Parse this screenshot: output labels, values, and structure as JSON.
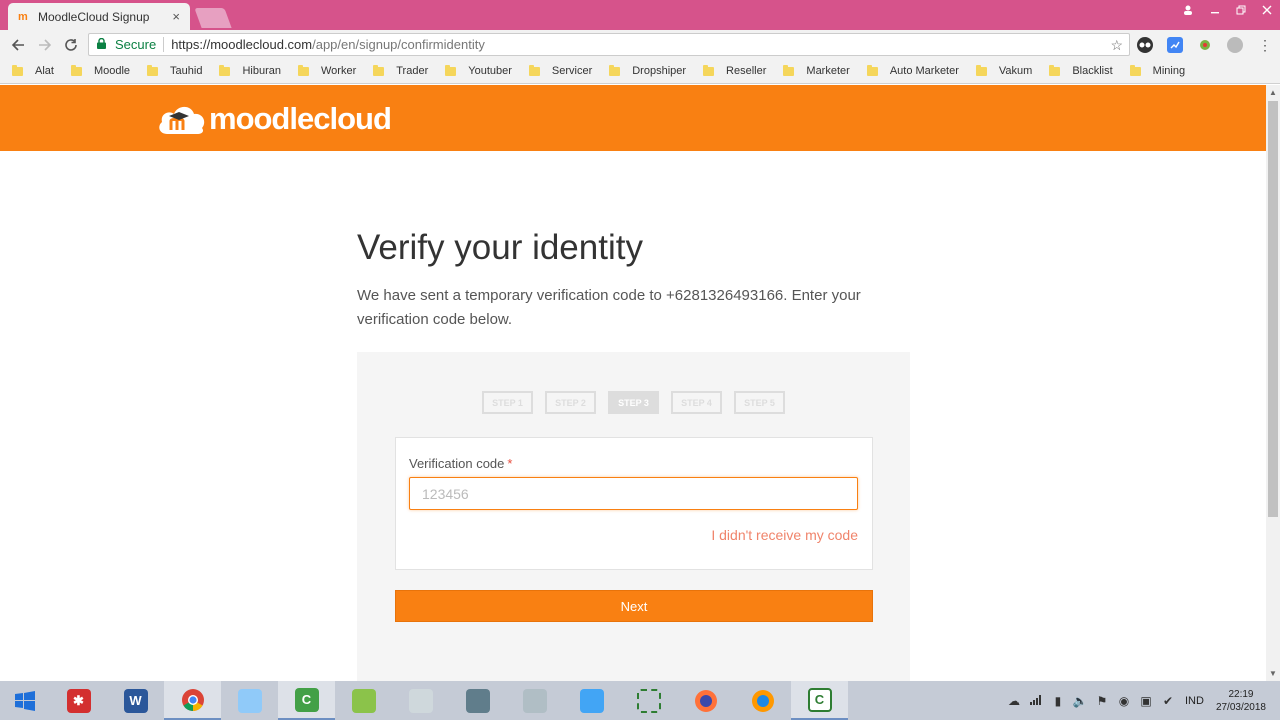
{
  "browser": {
    "tab_title": "MoodleCloud Signup",
    "tab_close": "×",
    "secure_label": "Secure",
    "url_host": "https://moodlecloud.com",
    "url_path": "/app/en/signup/confirmidentity",
    "bookmarks": [
      "Alat",
      "Moodle",
      "Tauhid",
      "Hiburan",
      "Worker",
      "Trader",
      "Youtuber",
      "Servicer",
      "Dropshiper",
      "Reseller",
      "Marketer",
      "Auto Marketer",
      "Vakum",
      "Blacklist",
      "Mining"
    ]
  },
  "site": {
    "logo_text": "moodlecloud"
  },
  "page": {
    "title": "Verify your identity",
    "description": "We have sent a temporary verification code to +6281326493166. Enter your verification code below.",
    "steps": [
      "STEP 1",
      "STEP 2",
      "STEP 3",
      "STEP 4",
      "STEP 5"
    ],
    "active_step": 3,
    "form": {
      "label": "Verification code",
      "required_mark": "*",
      "placeholder": "123456",
      "value": "",
      "resend_link": "I didn't receive my code"
    },
    "next_button": "Next"
  },
  "taskbar": {
    "language": "IND",
    "time": "22:19",
    "date": "27/03/2018"
  },
  "colors": {
    "brand_orange": "#f98012",
    "titlebar_pink": "#d6538b",
    "link_salmon": "#f0846b"
  }
}
